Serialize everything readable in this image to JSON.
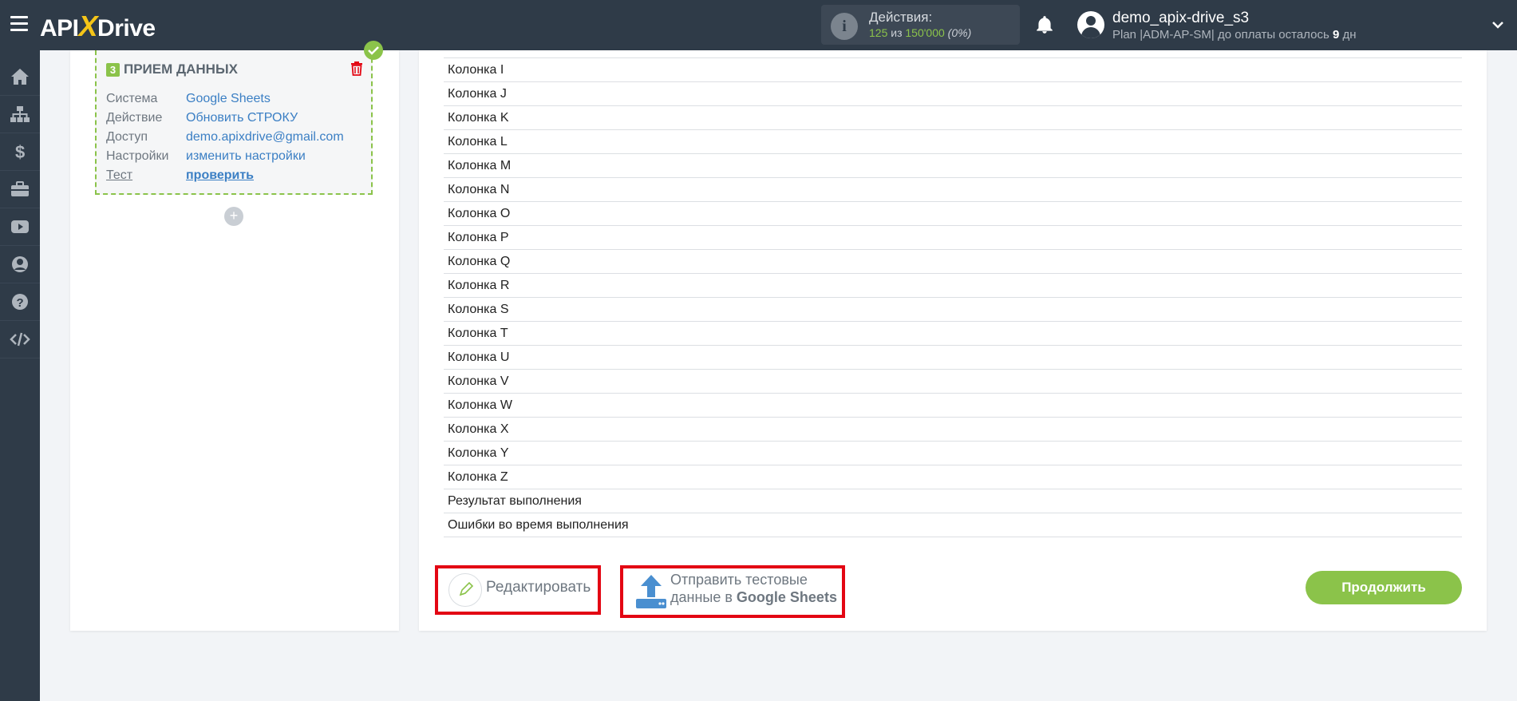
{
  "header": {
    "logo_api": "API",
    "logo_x": "X",
    "logo_drive": "Drive",
    "actions_label": "Действия:",
    "actions_used": "125",
    "actions_of": "из",
    "actions_total": "150'000",
    "actions_pct": "(0%)",
    "username": "demo_apix-drive_s3",
    "plan_prefix": "Plan |ADM-AP-SM| до оплаты осталось",
    "plan_days": "9",
    "plan_suffix": "дн"
  },
  "sidebar": {
    "icons": [
      "home-icon",
      "sitemap-icon",
      "dollar-icon",
      "briefcase-icon",
      "youtube-icon",
      "user-icon",
      "help-icon",
      "code-icon"
    ]
  },
  "step": {
    "number": "3",
    "title": "ПРИЕМ ДАННЫХ",
    "rows": [
      {
        "key": "Система",
        "value": "Google Sheets"
      },
      {
        "key": "Действие",
        "value": "Обновить СТРОКУ"
      },
      {
        "key": "Доступ",
        "value": "demo.apixdrive@gmail.com"
      },
      {
        "key": "Настройки",
        "value": "изменить настройки"
      },
      {
        "key": "Тест",
        "value": "проверить"
      }
    ],
    "add_label": "+"
  },
  "fields": [
    "Колонка I",
    "Колонка J",
    "Колонка K",
    "Колонка L",
    "Колонка M",
    "Колонка N",
    "Колонка O",
    "Колонка P",
    "Колонка Q",
    "Колонка R",
    "Колонка S",
    "Колонка T",
    "Колонка U",
    "Колонка V",
    "Колонка W",
    "Колонка X",
    "Колонка Y",
    "Колонка Z",
    "Результат выполнения",
    "Ошибки во время выполнения"
  ],
  "buttons": {
    "edit": "Редактировать",
    "send_line1": "Отправить тестовые",
    "send_line2_prefix": "данные в",
    "send_line2_system": "Google Sheets",
    "continue": "Продолжить"
  },
  "colors": {
    "accent_green": "#8bc34a",
    "topbar": "#2f3b48",
    "highlight_red": "#e30613",
    "link_blue": "#3b7fc4"
  }
}
